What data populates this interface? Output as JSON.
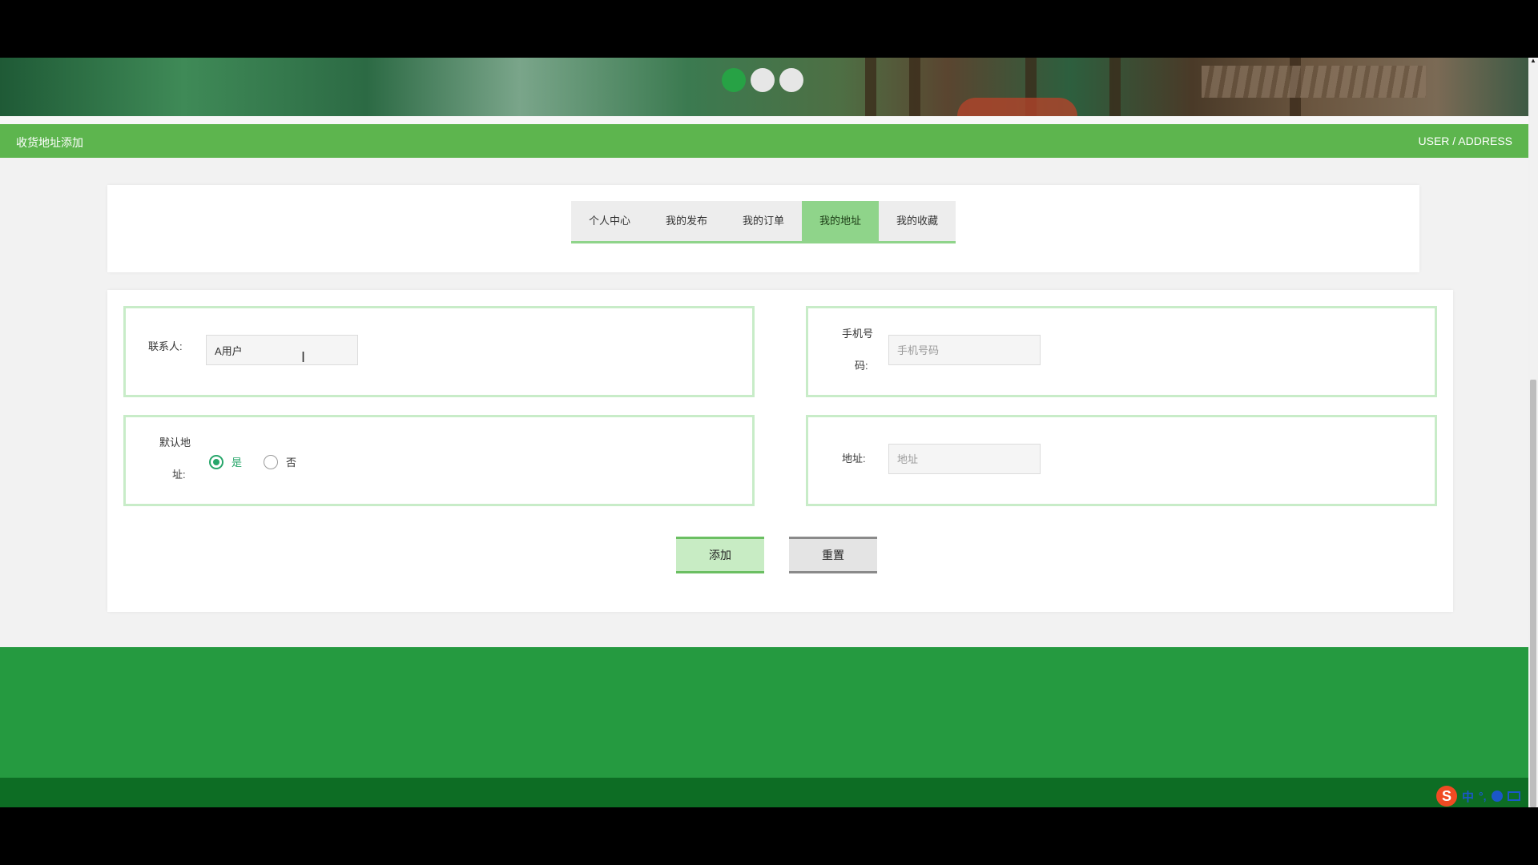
{
  "header": {
    "page_title": "收货地址添加",
    "breadcrumb": "USER / ADDRESS"
  },
  "banner": {
    "slides": 3,
    "active_slide": 1
  },
  "tabs": [
    {
      "label": "个人中心",
      "active": false
    },
    {
      "label": "我的发布",
      "active": false
    },
    {
      "label": "我的订单",
      "active": false
    },
    {
      "label": "我的地址",
      "active": true
    },
    {
      "label": "我的收藏",
      "active": false
    }
  ],
  "form": {
    "contact": {
      "label": "联系人:",
      "value": "A用户"
    },
    "phone": {
      "label_line1": "手机号",
      "label_line2": "码:",
      "placeholder": "手机号码",
      "value": ""
    },
    "default_address": {
      "label_line1": "默认地",
      "label_line2": "址:",
      "options": [
        {
          "label": "是",
          "checked": true
        },
        {
          "label": "否",
          "checked": false
        }
      ]
    },
    "address": {
      "label": "地址:",
      "placeholder": "地址",
      "value": ""
    }
  },
  "buttons": {
    "add": "添加",
    "reset": "重置"
  },
  "ime": {
    "logo": "S",
    "mode": "中",
    "punct": "°,"
  },
  "colors": {
    "title_bar": "#5db54e",
    "active_tab": "#8fd48a",
    "footer": "#259a40",
    "footer_bottom": "#0d6d24",
    "radio_checked": "#27a66a"
  }
}
